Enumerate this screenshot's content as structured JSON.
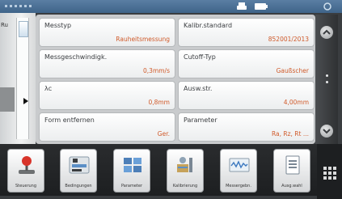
{
  "cards": [
    {
      "label": "Messtyp",
      "value": "Rauheitsmessung"
    },
    {
      "label": "Kalibr.standard",
      "value": "852001/2013"
    },
    {
      "label": "Messgeschwindigk.",
      "value": "0,3mm/s"
    },
    {
      "label": "Cutoff-Typ",
      "value": "Gaußscher"
    },
    {
      "label": "λc",
      "value": "0,8mm"
    },
    {
      "label": "Ausw.str.",
      "value": "4,00mm"
    },
    {
      "label": "Form entfernen",
      "value": "Ger."
    },
    {
      "label": "Parameter",
      "value": "Ra, Rz, Rt ..."
    }
  ],
  "left_fragment": "Ru",
  "toolbar": [
    {
      "label": "Steuerung",
      "icon": "joystick-icon"
    },
    {
      "label": "Bedingungen",
      "icon": "conditions-icon"
    },
    {
      "label": "Parameter",
      "icon": "parameter-icon"
    },
    {
      "label": "Kalibrierung",
      "icon": "calibration-icon"
    },
    {
      "label": "Messergebn.",
      "icon": "results-icon"
    },
    {
      "label": "Ausg.wahl",
      "icon": "output-icon"
    }
  ],
  "colors": {
    "value_text": "#d05a2a",
    "status_bar": "#4a6f95"
  }
}
